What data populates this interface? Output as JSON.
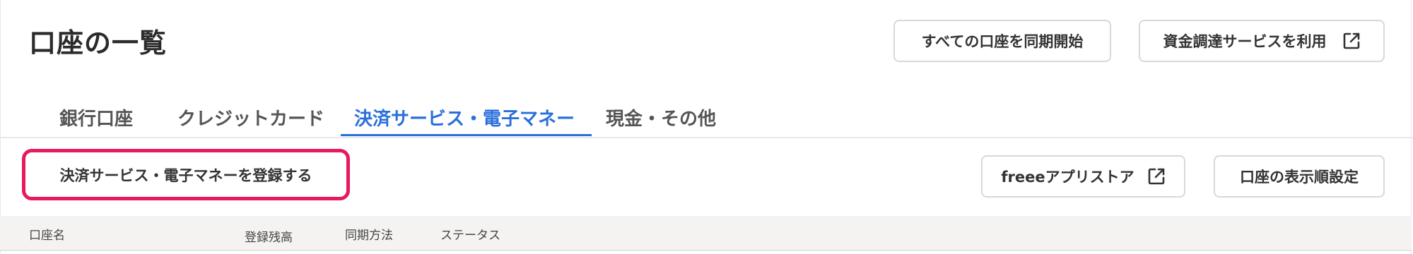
{
  "header": {
    "title": "口座の一覧",
    "sync_all_label": "すべての口座を同期開始",
    "funding_label": "資金調達サービスを利用",
    "funding_icon": "external-link-icon"
  },
  "tabs": [
    {
      "label": "銀行口座",
      "active": false
    },
    {
      "label": "クレジットカード",
      "active": false
    },
    {
      "label": "決済サービス・電子マネー",
      "active": true
    },
    {
      "label": "現金・その他",
      "active": false
    }
  ],
  "toolbar": {
    "register_label": "決済サービス・電子マネーを登録する",
    "appstore_label": "freeeアプリストア",
    "appstore_icon": "external-link-icon",
    "order_label": "口座の表示順設定"
  },
  "table": {
    "columns": [
      "口座名",
      "登録残高",
      "同期方法",
      "ステータス"
    ]
  },
  "colors": {
    "accent": "#2a6fdb",
    "highlight": "#e8195c",
    "header_bg": "#f4f3f2"
  }
}
